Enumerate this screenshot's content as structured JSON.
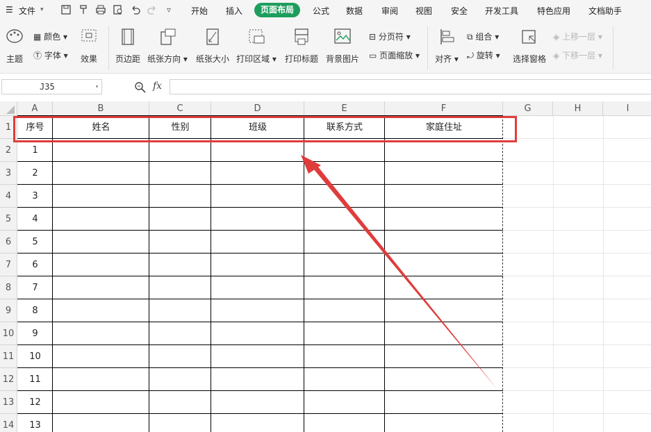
{
  "menubar": {
    "file_label": "文件",
    "tabs": [
      "开始",
      "插入",
      "页面布局",
      "公式",
      "数据",
      "审阅",
      "视图",
      "安全",
      "开发工具",
      "特色应用",
      "文档助手"
    ],
    "active_tab": "页面布局"
  },
  "ribbon": {
    "theme": "主题",
    "color": "颜色",
    "font": "字体",
    "effect": "效果",
    "margins": "页边距",
    "orientation": "纸张方向",
    "size": "纸张大小",
    "print_area": "打印区域",
    "print_titles": "打印标题",
    "background": "背景图片",
    "page_break": "分页符",
    "page_zoom": "页面缩放",
    "align": "对齐",
    "group": "组合",
    "rotate": "旋转",
    "select_pane": "选择窗格",
    "bring_forward": "上移一层",
    "send_backward": "下移一层"
  },
  "formula_bar": {
    "name_box": "J35",
    "fx_label": "fx",
    "formula": ""
  },
  "sheet": {
    "columns": [
      "A",
      "B",
      "C",
      "D",
      "E",
      "F",
      "G",
      "H",
      "I"
    ],
    "row_numbers": [
      "1",
      "2",
      "3",
      "4",
      "5",
      "6",
      "7",
      "8",
      "9",
      "10",
      "11",
      "12",
      "13",
      "14"
    ],
    "header_row": [
      "序号",
      "姓名",
      "性别",
      "班级",
      "联系方式",
      "家庭住址"
    ],
    "serial_numbers": [
      "1",
      "2",
      "3",
      "4",
      "5",
      "6",
      "7",
      "8",
      "9",
      "10",
      "11",
      "12",
      "13"
    ]
  },
  "annotation": {
    "highlight_color": "#e03c3c",
    "arrow_color": "#e03c3c"
  },
  "colors": {
    "accent": "#1e9e5d",
    "grid_line": "#e6e6e6",
    "header_bg": "#f2f2f2"
  }
}
